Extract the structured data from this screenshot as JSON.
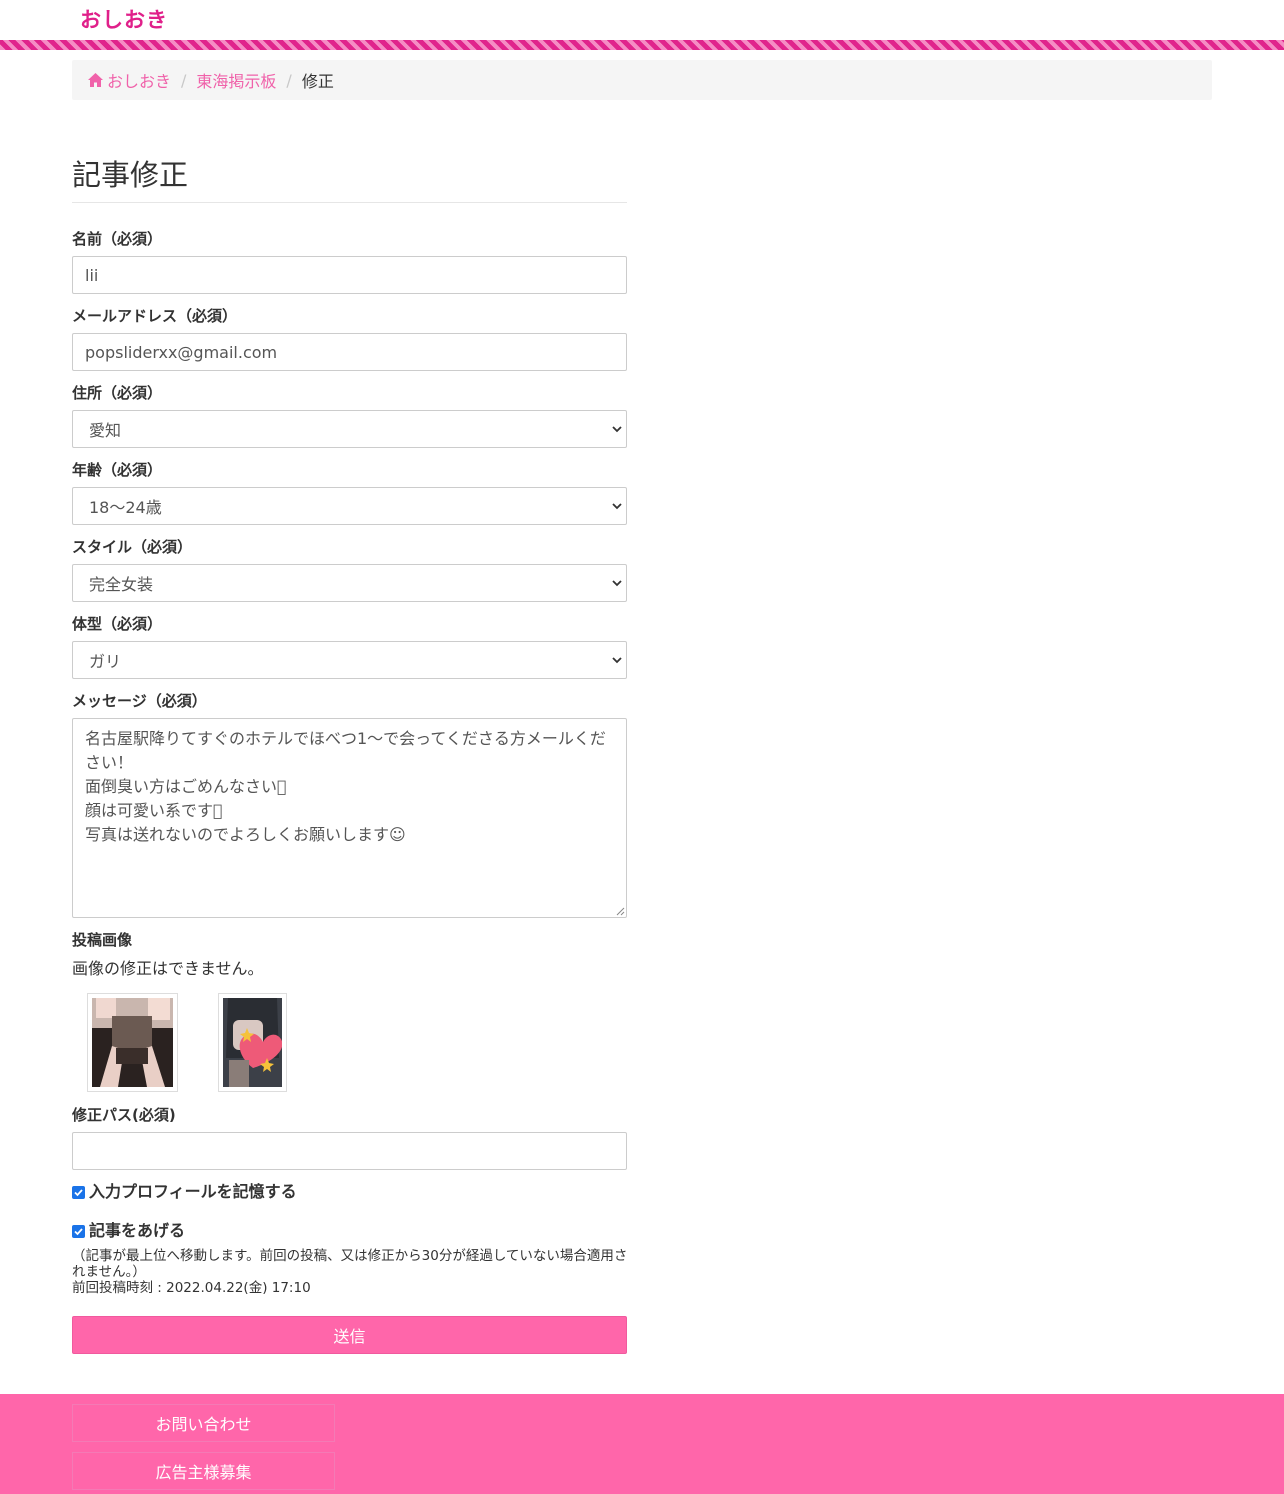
{
  "header": {
    "logo": "おしおき"
  },
  "breadcrumb": {
    "home": "おしおき",
    "board": "東海掲示板",
    "current": "修正"
  },
  "page": {
    "title": "記事修正"
  },
  "form": {
    "name": {
      "label": "名前（必須）",
      "value": "lii"
    },
    "email": {
      "label": "メールアドレス（必須）",
      "value": "popsliderxx@gmail.com"
    },
    "address": {
      "label": "住所（必須）",
      "selected": "愛知"
    },
    "age": {
      "label": "年齢（必須）",
      "selected": "18〜24歳"
    },
    "style": {
      "label": "スタイル（必須）",
      "selected": "完全女装"
    },
    "body_type": {
      "label": "体型（必須）",
      "selected": "ガリ"
    },
    "message": {
      "label": "メッセージ（必須）",
      "value": "名古屋駅降りてすぐのホテルでほべつ1〜で会ってくださる方メールください！\n面倒臭い方はごめんなさい􀀀\n顔は可愛い系です􀀀\n写真は送れないのでよろしくお願いします☺"
    },
    "images": {
      "label": "投稿画像",
      "note": "画像の修正はできません。"
    },
    "edit_pass": {
      "label": "修正パス(必須)",
      "value": ""
    },
    "remember_profile": {
      "label": "入力プロフィールを記憶する",
      "checked": true
    },
    "bump": {
      "label": "記事をあげる",
      "checked": true,
      "note": "（記事が最上位へ移動します。前回の投稿、又は修正から30分が経過していない場合適用されません。）",
      "last_post": "前回投稿時刻 : 2022.04.22(金) 17:10"
    },
    "submit_label": "送信"
  },
  "footer": {
    "contact": "お問い合わせ",
    "advertisers": "広告主様募集"
  },
  "colors": {
    "brand_pink": "#ff66aa",
    "logo_pink": "#e0208a",
    "link_pink": "#f062aa",
    "checkbox_blue": "#1a73e8"
  }
}
